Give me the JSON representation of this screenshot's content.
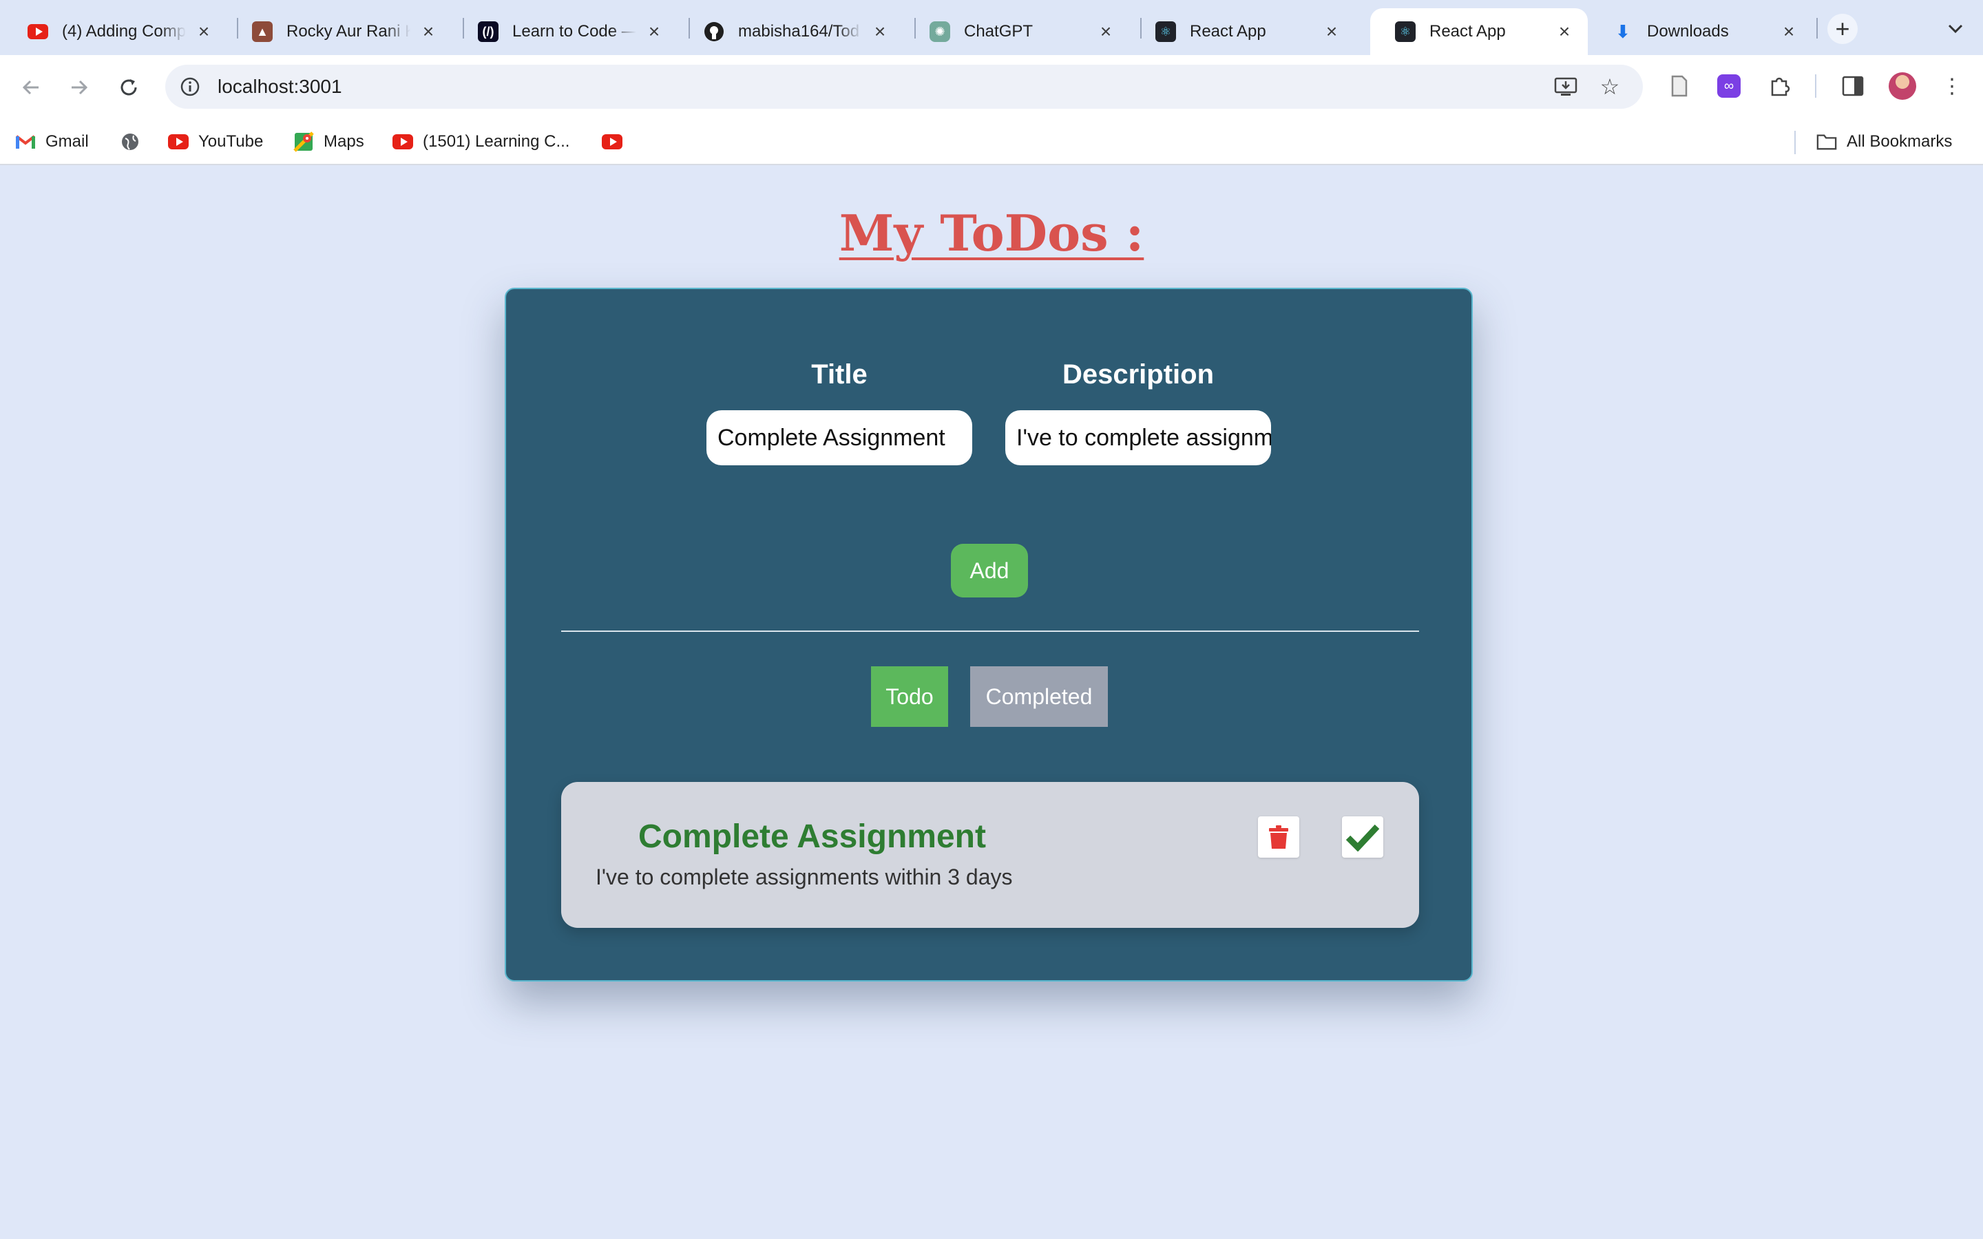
{
  "browser": {
    "tabs": [
      {
        "title": "(4) Adding Comp",
        "icon": "youtube-icon",
        "active": false
      },
      {
        "title": "Rocky Aur Rani K",
        "icon": "movie-icon",
        "active": false
      },
      {
        "title": "Learn to Code —",
        "icon": "freecodecamp-icon",
        "active": false
      },
      {
        "title": "mabisha164/Tod",
        "icon": "github-icon",
        "active": false
      },
      {
        "title": "ChatGPT",
        "icon": "chatgpt-icon",
        "active": false
      },
      {
        "title": "React App",
        "icon": "react-icon",
        "active": false
      },
      {
        "title": "React App",
        "icon": "react-icon",
        "active": true
      },
      {
        "title": "Downloads",
        "icon": "download-icon",
        "active": false
      }
    ],
    "new_tab_symbol": "+",
    "address": "localhost:3001",
    "bookmarks": [
      {
        "label": "Gmail",
        "icon": "gmail-icon"
      },
      {
        "label": "",
        "icon": "globe-icon"
      },
      {
        "label": "YouTube",
        "icon": "youtube-icon"
      },
      {
        "label": "Maps",
        "icon": "maps-icon"
      },
      {
        "label": "(1501) Learning C...",
        "icon": "youtube-icon"
      },
      {
        "label": "",
        "icon": "youtube-icon"
      }
    ],
    "all_bookmarks": "All Bookmarks"
  },
  "app": {
    "heading": "My ToDos :",
    "title_label": "Title",
    "description_label": "Description",
    "title_value": "Complete Assignment",
    "description_value": "I've to complete assignm",
    "add_label": "Add",
    "tab_todo": "Todo",
    "tab_completed": "Completed",
    "todo": {
      "title": "Complete Assignment",
      "description": "I've to complete assignments within 3 days"
    }
  },
  "colors": {
    "page_bg": "#dfe7f8",
    "card_bg": "#2d5b73",
    "heading": "#d9534f",
    "green": "#5cb85c",
    "todo_title": "#2e7d32",
    "gray_tab": "#9ba2b0",
    "delete_red": "#e53935"
  }
}
